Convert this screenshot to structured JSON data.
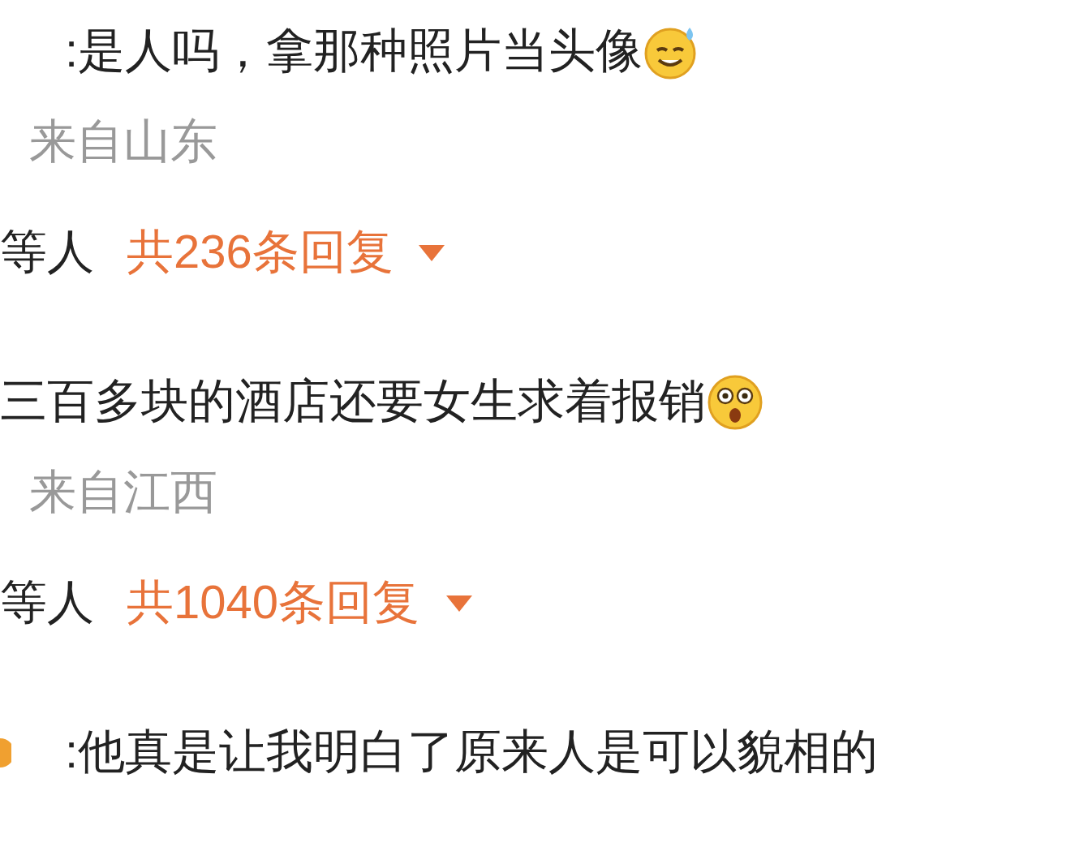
{
  "comments": [
    {
      "text": ":是人吗，拿那种照片当头像",
      "emoji": {
        "kind": "sweat"
      },
      "location": "来自山东",
      "replies_prefix": "等人",
      "reply_count": "共236条回复"
    },
    {
      "text": "三百多块的酒店还要女生求着报销",
      "emoji": {
        "kind": "shocked"
      },
      "location": "来自江西",
      "replies_prefix": "等人",
      "reply_count": "共1040条回复"
    },
    {
      "text": ":他真是让我明白了原来人是可以貌相的",
      "lead_emoji": {
        "kind": "partial"
      }
    }
  ]
}
